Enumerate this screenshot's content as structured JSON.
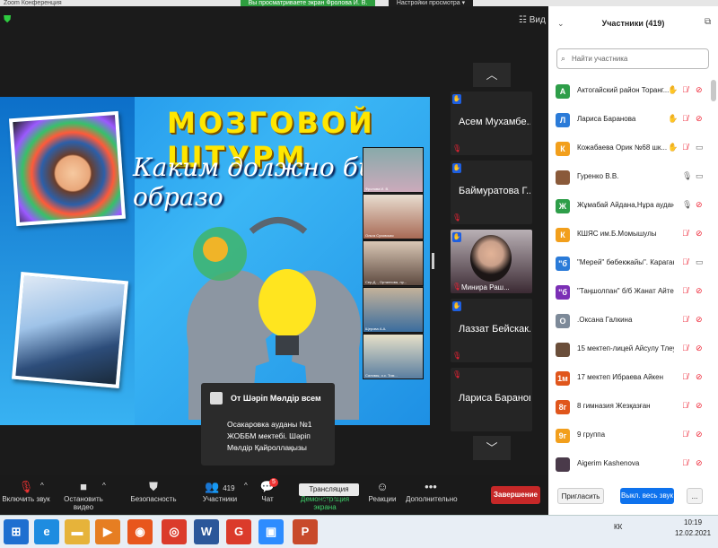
{
  "window": {
    "title": "Zoom Конференция"
  },
  "banner": {
    "share_text": "Вы просматриваете экран Фролова И. В.",
    "view_options": "Настройки просмотра ▾",
    "view_label": "Вид"
  },
  "slide": {
    "title": "МОЗГОВОЙ ШТУРМ",
    "subtitle": "Каким должно быть образо",
    "gallery": [
      "Фролова И. В.",
      "Ольга Суховская",
      "Сер-Д.., Ортаннова, лр...",
      "Щерова А.А.",
      "Салимы, о.с. Тим..."
    ]
  },
  "video_tiles": [
    {
      "name": "Асем  Мухамбе...",
      "hand": true
    },
    {
      "name": "Баймуратова  Г...",
      "hand": true
    },
    {
      "name": "Минира Раш...",
      "hand": true,
      "has_video": true
    },
    {
      "name": "Лаззат  Бейскак...",
      "hand": true
    },
    {
      "name": "Лариса Баранова",
      "hand": false
    }
  ],
  "chat_popup": {
    "from": "От Шәріп Мөлдір всем",
    "message": "Осакаровка ауданы №1 ЖОББМ мектебі.  Шәріп Мөлдір Қайроллақызы"
  },
  "toolbar": {
    "unmute": "Включить звук",
    "start_video": "Остановить видео",
    "security": "Безопасность",
    "participants": "Участники",
    "participants_count": "419",
    "chat": "Чат",
    "chat_badge": "5",
    "share": "Демонстрация экрана",
    "reactions": "Реакции",
    "more": "Дополнительно",
    "end": "Завершение",
    "tooltip": "Трансляция (Alt+S)"
  },
  "participants_panel": {
    "title": "Участники (419)",
    "search_placeholder": "Найти участника",
    "invite": "Пригласить",
    "mute_all": "Выкл. весь звук",
    "more": "...",
    "list": [
      {
        "initial": "А",
        "color": "#2e9e49",
        "name": "Актогайский район Торанг...",
        "hand": true,
        "mic": "muted",
        "video": "off"
      },
      {
        "initial": "Л",
        "color": "#2b7bd8",
        "name": "Лариса Баранова",
        "hand": true,
        "mic": "muted",
        "video": "off"
      },
      {
        "initial": "К",
        "color": "#f29f1c",
        "name": "Кожабаева Орик №68 шк...",
        "hand": true,
        "mic": "muted",
        "video": "on"
      },
      {
        "initial": "",
        "color": "#8a5a3a",
        "name": "Гуренко В.В.",
        "hand": false,
        "mic": "on",
        "video": "on"
      },
      {
        "initial": "Ж",
        "color": "#2e9e49",
        "name": "Жұмабай Айдана,Нұра ауданы...",
        "hand": false,
        "mic": "on",
        "video": "off"
      },
      {
        "initial": "К",
        "color": "#f29f1c",
        "name": "КШЯС им.Б.Момышулы",
        "hand": false,
        "mic": "muted",
        "video": "off"
      },
      {
        "initial": "\"б",
        "color": "#2b7bd8",
        "name": "\"Мерей\" бөбекжайы\". Караган...",
        "hand": false,
        "mic": "muted",
        "video": "on"
      },
      {
        "initial": "\"б",
        "color": "#7b2fb5",
        "name": "\"Таңшолпан\" б/б Жанат Айтее...",
        "hand": false,
        "mic": "muted",
        "video": "off"
      },
      {
        "initial": "О",
        "color": "#7d8a99",
        "name": ".Оксана Галкина",
        "hand": false,
        "mic": "muted",
        "video": "off"
      },
      {
        "initial": "",
        "color": "#6a4e3a",
        "name": "15 мектеп-лицей Айсулу Тлеуб...",
        "hand": false,
        "mic": "muted",
        "video": "off"
      },
      {
        "initial": "1м",
        "color": "#e0561c",
        "name": "17 мектеп Ибраева Айкен",
        "hand": false,
        "mic": "muted",
        "video": "off"
      },
      {
        "initial": "8г",
        "color": "#e0561c",
        "name": "8 гимназия Жезқазған",
        "hand": false,
        "mic": "muted",
        "video": "off"
      },
      {
        "initial": "9г",
        "color": "#f29f1c",
        "name": "9 группа",
        "hand": false,
        "mic": "muted",
        "video": "off"
      },
      {
        "initial": "",
        "color": "#4a3a4a",
        "name": "Aigerim Kashenova",
        "hand": false,
        "mic": "muted",
        "video": "off"
      }
    ]
  },
  "taskbar": {
    "apps": [
      {
        "icon": "windows-start-icon",
        "glyph": "⊞",
        "color": "#1e6fd0"
      },
      {
        "icon": "internet-explorer-icon",
        "glyph": "e",
        "color": "#1e8ce0"
      },
      {
        "icon": "file-explorer-icon",
        "glyph": "▬",
        "color": "#e6b33a"
      },
      {
        "icon": "media-player-icon",
        "glyph": "▶",
        "color": "#e67e22"
      },
      {
        "icon": "firefox-icon",
        "glyph": "◉",
        "color": "#e8561c"
      },
      {
        "icon": "chrome-icon",
        "glyph": "◎",
        "color": "#db3b2b"
      },
      {
        "icon": "word-icon",
        "glyph": "W",
        "color": "#2b579a"
      },
      {
        "icon": "chrome-profile-icon",
        "glyph": "G",
        "color": "#db3b2b"
      },
      {
        "icon": "zoom-icon",
        "glyph": "▣",
        "color": "#2d8cff"
      },
      {
        "icon": "powerpoint-icon",
        "glyph": "P",
        "color": "#c84a2b"
      }
    ],
    "language": "КК",
    "time": "10:19",
    "date": "12.02.2021"
  }
}
